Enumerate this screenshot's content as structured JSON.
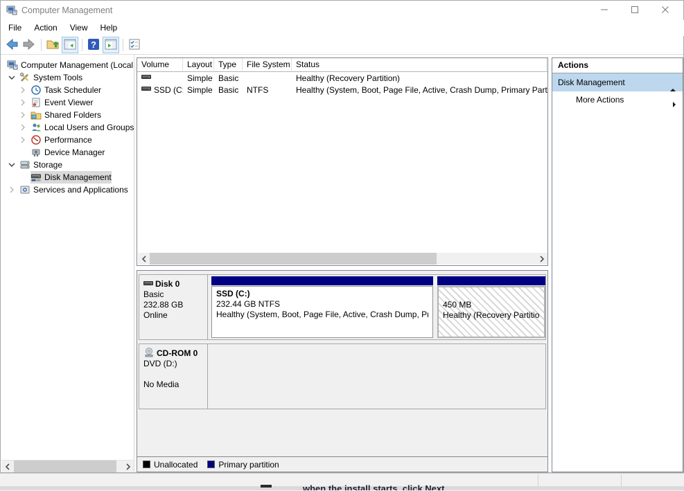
{
  "window": {
    "title": "Computer Management",
    "controls": [
      {
        "name": "minimize",
        "icon": "minimize-icon"
      },
      {
        "name": "maximize",
        "icon": "maximize-icon"
      },
      {
        "name": "close",
        "icon": "close-icon"
      }
    ]
  },
  "menu": {
    "items": [
      "File",
      "Action",
      "View",
      "Help"
    ]
  },
  "toolbar": {
    "items": [
      {
        "name": "back",
        "icon": "back-arrow-icon",
        "highlighted": false
      },
      {
        "name": "forward",
        "icon": "forward-arrow-icon",
        "highlighted": false
      },
      {
        "separator": true
      },
      {
        "name": "up-one-level",
        "icon": "folder-up-icon",
        "highlighted": false
      },
      {
        "name": "show-console-tree",
        "icon": "console-tree-icon",
        "highlighted": true
      },
      {
        "separator": true
      },
      {
        "name": "help",
        "icon": "help-icon",
        "highlighted": false
      },
      {
        "name": "show-action-pane",
        "icon": "action-pane-icon",
        "highlighted": true
      },
      {
        "separator": true
      },
      {
        "name": "customize",
        "icon": "export-list-icon",
        "highlighted": false
      }
    ]
  },
  "tree": {
    "items": [
      {
        "label": "Computer Management (Local",
        "depth": 0,
        "chevron": null,
        "icon": "computer-icon",
        "selected": false
      },
      {
        "label": "System Tools",
        "depth": 1,
        "chevron": "expanded",
        "icon": "system-tools-icon",
        "selected": false
      },
      {
        "label": "Task Scheduler",
        "depth": 2,
        "chevron": "collapsed",
        "icon": "task-scheduler-icon",
        "selected": false
      },
      {
        "label": "Event Viewer",
        "depth": 2,
        "chevron": "collapsed",
        "icon": "event-viewer-icon",
        "selected": false
      },
      {
        "label": "Shared Folders",
        "depth": 2,
        "chevron": "collapsed",
        "icon": "shared-folders-icon",
        "selected": false
      },
      {
        "label": "Local Users and Groups",
        "depth": 2,
        "chevron": "collapsed",
        "icon": "users-groups-icon",
        "selected": false
      },
      {
        "label": "Performance",
        "depth": 2,
        "chevron": "collapsed",
        "icon": "performance-icon",
        "selected": false
      },
      {
        "label": "Device Manager",
        "depth": 2,
        "chevron": null,
        "icon": "device-manager-icon",
        "selected": false
      },
      {
        "label": "Storage",
        "depth": 1,
        "chevron": "expanded",
        "icon": "storage-icon",
        "selected": false
      },
      {
        "label": "Disk Management",
        "depth": 2,
        "chevron": null,
        "icon": "disk-management-icon",
        "selected": true
      },
      {
        "label": "Services and Applications",
        "depth": 1,
        "chevron": "collapsed",
        "icon": "services-icon",
        "selected": false
      }
    ]
  },
  "volume_list": {
    "columns": [
      "Volume",
      "Layout",
      "Type",
      "File System",
      "Status"
    ],
    "rows": [
      {
        "icon": "volume-icon",
        "volume": "",
        "layout": "Simple",
        "type": "Basic",
        "file_system": "",
        "status": "Healthy (Recovery Partition)"
      },
      {
        "icon": "volume-icon",
        "volume": "SSD (C:)",
        "layout": "Simple",
        "type": "Basic",
        "file_system": "NTFS",
        "status": "Healthy (System, Boot, Page File, Active, Crash Dump, Primary Partiti"
      }
    ]
  },
  "disk_view": {
    "disks": [
      {
        "name": "Disk 0",
        "icon": "disk-icon",
        "lines": [
          "Basic",
          "232.88 GB",
          "Online"
        ],
        "partitions": [
          {
            "name": "SSD (C:)",
            "size_line": "232.44 GB NTFS",
            "status_line": "Healthy (System, Boot, Page File, Active, Crash Dump, Prim",
            "hatched": false
          },
          {
            "name": "",
            "size_line": "450 MB",
            "status_line": "Healthy (Recovery Partition)",
            "hatched": true
          }
        ]
      },
      {
        "name": "CD-ROM 0",
        "icon": "cd-rom-icon",
        "lines": [
          "DVD (D:)",
          "",
          "No Media"
        ],
        "partitions": []
      }
    ],
    "legend": [
      {
        "label": "Unallocated",
        "color": "#000000"
      },
      {
        "label": "Primary partition",
        "color": "#000082"
      }
    ]
  },
  "actions": {
    "title": "Actions",
    "group_label": "Disk Management",
    "more_label": "More Actions"
  },
  "background": {
    "clipped_text": "when the install starts, click Next"
  },
  "colors": {
    "partition_header": "#000082",
    "actions_selection": "#bcd7ee",
    "tree_selection": "#d9d9d9"
  }
}
